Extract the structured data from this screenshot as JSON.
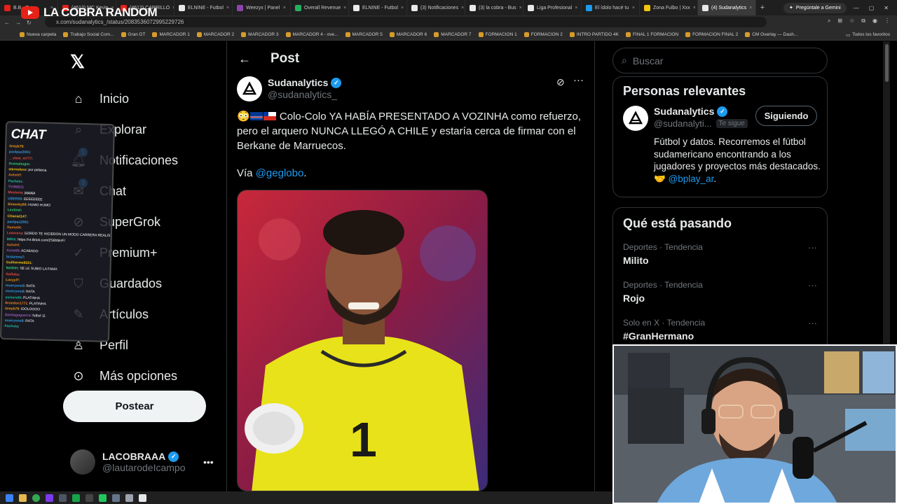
{
  "stream": {
    "title": "LA COBRA RANDOM"
  },
  "browser": {
    "tabs": [
      {
        "label": "B.B - Ext",
        "color": "#e62117"
      },
      {
        "label": "(4612) MC Kevin",
        "color": "#e62117"
      },
      {
        "label": "(4612) CARRILLO",
        "color": "#e62117"
      },
      {
        "label": "ELNINE - Futbol",
        "color": "#e7e9ea"
      },
      {
        "label": "Weezyx | Panel",
        "color": "#8e44ad"
      },
      {
        "label": "Overall Revenue",
        "color": "#27ae60"
      },
      {
        "label": "ELNINE - Futbol",
        "color": "#e7e9ea"
      },
      {
        "label": "(3) Notificaciones",
        "color": "#e7e9ea"
      },
      {
        "label": "(3) la cobra - Bus",
        "color": "#e7e9ea"
      },
      {
        "label": "Liga Profesional",
        "color": "#e7e9ea"
      },
      {
        "label": "El ídolo hacé tu",
        "color": "#1d9bf0"
      },
      {
        "label": "Zona Fulbo | Xxx",
        "color": "#f1c40f"
      },
      {
        "label": "(4) Sudanalytics",
        "color": "#e7e9ea"
      }
    ],
    "gemini_label": "Pregúntale a Gemini",
    "url": "x.com/sudanalytics_/status/2083536072995229726",
    "bookmarks": [
      "Nueva carpeta",
      "Trabajo Social Com...",
      "Gran DT",
      "MARCADOR 1",
      "MARCADOR 2",
      "MARCADOR 3",
      "MARCADOR 4 - ove...",
      "MARCADOR 5",
      "MARCADOR 6",
      "MARCADOR 7",
      "FORMACION 1",
      "FORMACION 2",
      "INTRO PARTIDO 4K",
      "FINAL 1 FORMACION",
      "FORMACION FINAL 2",
      "CM Overlay — Dash..."
    ],
    "bookmarks_all": "Todos los favoritos"
  },
  "nav": {
    "items": [
      {
        "label": "Inicio",
        "icon": "home-icon"
      },
      {
        "label": "Explorar",
        "icon": "search-icon"
      },
      {
        "label": "Notificaciones",
        "icon": "bell-icon",
        "badge": "1"
      },
      {
        "label": "Chat",
        "icon": "chat-icon",
        "badge": "3"
      },
      {
        "label": "SuperGrok",
        "icon": "grok-icon"
      },
      {
        "label": "Premium+",
        "icon": "premium-icon"
      },
      {
        "label": "Guardados",
        "icon": "bookmark-icon"
      },
      {
        "label": "Artículos",
        "icon": "articles-icon"
      },
      {
        "label": "Perfil",
        "icon": "profile-icon"
      },
      {
        "label": "Más opciones",
        "icon": "more-icon"
      }
    ],
    "post_button": "Postear",
    "account": {
      "name": "LACOBRAAA",
      "handle": "@lautarodeIcampo"
    }
  },
  "post": {
    "header": "Post",
    "author": {
      "name": "Sudanalytics",
      "handle": "@sudanalytics_"
    },
    "text": "Colo-Colo YA HABÍA PRESENTADO A VOZINHA como refuerzo, pero el arquero NUNCA LLEGÓ A CHILE y estaría cerca de firmar con el Berkane de Marruecos.",
    "via_prefix": "Vía ",
    "via_link": "@geglobo",
    "via_suffix": "."
  },
  "sidebar": {
    "search_placeholder": "Buscar",
    "relevant": {
      "title": "Personas relevantes",
      "name": "Sudanalytics",
      "handle": "@sudanalyti...",
      "follows_you": "Te sigue",
      "following_label": "Siguiendo",
      "bio": "Fútbol y datos. Recorremos el fútbol sudamericano encontrando a los jugadores y proyectos más destacados. 🤝",
      "bio_link": "@bplay_ar",
      "bio_suffix": "."
    },
    "trends": {
      "title": "Qué está pasando",
      "items": [
        {
          "category": "Deportes · Tendencia",
          "name": "Milito"
        },
        {
          "category": "Deportes · Tendencia",
          "name": "Rojo"
        },
        {
          "category": "Solo en X · Tendencia",
          "name": "#GranHermano"
        }
      ]
    }
  },
  "chat_overlay": {
    "title": "CHAT",
    "lines": [
      {
        "user": "Greyb79",
        "msg": "",
        "color": "#f39c12"
      },
      {
        "user": "paulpaz2001",
        "msg": "",
        "color": "#3498db"
      },
      {
        "user": "__clem_m777",
        "msg": "",
        "color": "#e74c3c"
      },
      {
        "user": "Dramatiugio",
        "msg": "",
        "color": "#2ecc71"
      },
      {
        "user": "sternoleco",
        "msg": "por pelaesa",
        "color": "#f1c40f"
      },
      {
        "user": "Aohxlrf",
        "msg": "",
        "color": "#e67e22"
      },
      {
        "user": "Pacheto",
        "msg": "",
        "color": "#1abc9c"
      },
      {
        "user": "TV4N912",
        "msg": "",
        "color": "#9b59b6"
      },
      {
        "user": "Mosteria",
        "msg": "jajajaja",
        "color": "#e74c3c"
      },
      {
        "user": "USERS0",
        "msg": "EEEEEEEE",
        "color": "#3498db"
      },
      {
        "user": "Simonky69",
        "msg": "HUMO HUMO",
        "color": "#f39c12"
      },
      {
        "user": "Lectinel",
        "msg": "",
        "color": "#2ecc71"
      },
      {
        "user": "CDaniel147",
        "msg": "",
        "color": "#f1c40f"
      },
      {
        "user": "paulpaz2001",
        "msg": "",
        "color": "#3498db"
      },
      {
        "user": "Ramo04",
        "msg": "",
        "color": "#e67e22"
      },
      {
        "user": "Leanrexa",
        "msg": "GORDO TE HICIERON UN MODO CARRERA REALISTA",
        "color": "#e74c3c"
      },
      {
        "user": "MIRA",
        "msg": "https://vt.tiktok.com/ZS6hbkrF/",
        "color": "#1abc9c"
      },
      {
        "user": "Aohxlrf",
        "msg": "",
        "color": "#e67e22"
      },
      {
        "user": "Xorte95",
        "msg": "ACABADO",
        "color": "#9b59b6"
      },
      {
        "user": "braianma7",
        "msg": "",
        "color": "#3498db"
      },
      {
        "user": "Guilherme8321",
        "msg": "",
        "color": "#f1c40f"
      },
      {
        "user": "NettDH",
        "msg": "SE LE SUBIO LA FAMA",
        "color": "#2ecc71"
      },
      {
        "user": "Rofloka",
        "msg": "",
        "color": "#e74c3c"
      },
      {
        "user": "Lucyyl7",
        "msg": "",
        "color": "#f39c12"
      },
      {
        "user": "mueryone9",
        "msg": "RATA",
        "color": "#3498db"
      },
      {
        "user": "mueryone9",
        "msg": "RATA",
        "color": "#3498db"
      },
      {
        "user": "yuisoroth",
        "msg": "PLATINHA",
        "color": "#1abc9c"
      },
      {
        "user": "Brandon1771",
        "msg": "PLATINHA",
        "color": "#e67e22"
      },
      {
        "user": "Greyb79",
        "msg": "IDOLOOOO",
        "color": "#f39c12"
      },
      {
        "user": "Santiagoguerra",
        "msg": "futbol 11",
        "color": "#9b59b6"
      },
      {
        "user": "mueryone9",
        "msg": "RATA",
        "color": "#3498db"
      },
      {
        "user": "Pachota",
        "msg": "",
        "color": "#1abc9c"
      }
    ]
  },
  "colors": {
    "accent": "#1d9bf0",
    "text": "#e7e9ea",
    "muted": "#71767b",
    "border": "#2f3336"
  }
}
